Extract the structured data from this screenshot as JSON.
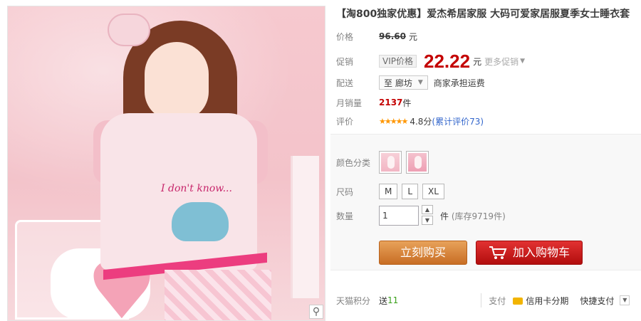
{
  "product": {
    "title": "【淘800独家优惠】爱杰希居家服 大码可爱家居服夏季女士睡衣套"
  },
  "price": {
    "label": "价格",
    "original": "96.60",
    "unit": "元"
  },
  "promo": {
    "label": "促销",
    "vip_tag": "VIP价格",
    "price": "22.22",
    "unit": "元",
    "more_link": "更多促销"
  },
  "shipping": {
    "label": "配送",
    "destination": "至 廊坊",
    "note": "商家承担运费"
  },
  "monthly_sales": {
    "label": "月销量",
    "count": "2137",
    "unit": "件"
  },
  "rating": {
    "label": "评价",
    "stars": "★★★★★",
    "score_text": "4.8分",
    "review_link": "(累计评价73)",
    "score": 4.8
  },
  "sku": {
    "color_label": "颜色分类",
    "colors": [
      "color-1",
      "color-2"
    ],
    "size_label": "尺码",
    "sizes": [
      "M",
      "L",
      "XL"
    ],
    "qty_label": "数量",
    "qty_value": "1",
    "qty_unit": "件",
    "stock_text": "(库存9719件)"
  },
  "actions": {
    "buy_now": "立刻购买",
    "add_to_cart": "加入购物车"
  },
  "footer": {
    "tmall_points_label": "天猫积分",
    "points_prefix": "送",
    "points_value": "11",
    "pay_label": "支付",
    "credit_card": "信用卡分期",
    "quick_pay": "快捷支付"
  },
  "photo": {
    "shirt_text": "I don't know...",
    "zoom_icon": "magnifier-icon"
  },
  "colors": {
    "price_red": "#c40000",
    "buy_button": "#d3843a",
    "cart_button": "#cc1d1d",
    "link_blue": "#3366cc",
    "star_orange": "#ff9600"
  }
}
